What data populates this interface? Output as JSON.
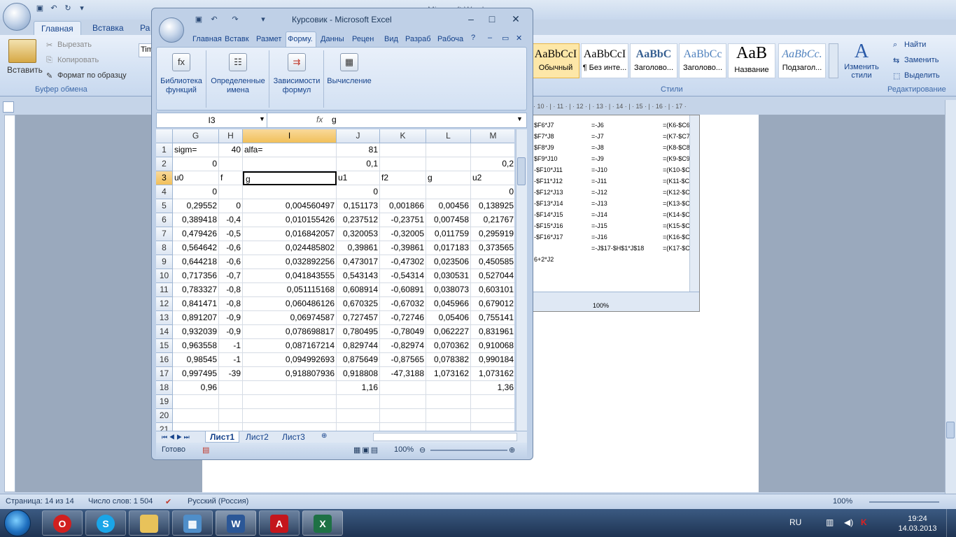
{
  "word": {
    "title": "Курсовик - Microsoft Word — документ … ерации - Microsoft Word",
    "title_visible": "ерации - Microsoft Word",
    "tabs": [
      "Главная",
      "Вставка",
      "Ра"
    ],
    "clipboard": {
      "paste": "Вставить",
      "cut": "Вырезать",
      "copy": "Копировать",
      "format_painter": "Формат по образцу",
      "group": "Буфер обмена"
    },
    "font_box": "Tim",
    "styles": [
      {
        "sample": "AaBbCcI",
        "name": "Обычный"
      },
      {
        "sample": "AaBbCcI",
        "name": "¶ Без инте..."
      },
      {
        "sample": "AaBbC",
        "name": "Заголово..."
      },
      {
        "sample": "AaBbCc",
        "name": "Заголово..."
      },
      {
        "sample": "AaB",
        "name": "Название"
      },
      {
        "sample": "AaBbCc.",
        "name": "Подзагол..."
      }
    ],
    "change_styles": "Изменить стили",
    "styles_group": "Стили",
    "editing": {
      "find": "Найти",
      "replace": "Заменить",
      "select": "Выделить",
      "group": "Редактирование"
    },
    "ruler_marks": "· 10 · | · 11 · | · 12 · | · 13 · | · 14 · | · 15 · | · 16 · | · 17 ·",
    "embedded": {
      "col1": [
        "$F6*J7",
        "$F7*J8",
        "$F8*J9",
        "$F9*J10",
        "-$F10*J11",
        "-$F11*J12",
        "-$F12*J13",
        "-$F13*J14",
        "-$F14*J15",
        "-$F15*J16",
        "-$F16*J17",
        "",
        "6+2*J2"
      ],
      "col2": [
        "=-J6",
        "=-J7",
        "=-J8",
        "=-J9",
        "=-J10",
        "=-J11",
        "=-J12",
        "=-J13",
        "=-J14",
        "=-J15",
        "=-J16",
        "=-J$17-$H$1*J$18",
        ""
      ],
      "col3": [
        "=(K6-$C6",
        "=(K7-$C7",
        "=(K8-$C8",
        "=(K9-$C9",
        "=(K10-$C",
        "=(K11-$C",
        "=(K12-$C",
        "=(K13-$C",
        "=(K14-$C",
        "=(K15-$C",
        "=(K16-$C",
        "=(K17-$C",
        ""
      ],
      "zoom": "100%"
    },
    "status": {
      "page": "Страница: 14 из 14",
      "words": "Число слов: 1 504",
      "language": "Русский (Россия)",
      "zoom": "100%"
    }
  },
  "excel": {
    "title": "Курсовик - Microsoft Excel",
    "tabs": [
      "Главная",
      "Вставк",
      "Размет",
      "Форму.",
      "Данны",
      "Рецен",
      "Вид",
      "Разраб",
      "Рабоча"
    ],
    "ribbon": [
      {
        "label1": "Библиотека",
        "label2": "функций",
        "icon": "fx"
      },
      {
        "label1": "Определенные",
        "label2": "имена",
        "icon": "names"
      },
      {
        "label1": "Зависимости",
        "label2": "формул",
        "icon": "deps"
      },
      {
        "label1": "Вычисление",
        "label2": "",
        "icon": "calc"
      }
    ],
    "namebox": "I3",
    "fx": "fx",
    "formula": "g",
    "columns": [
      "G",
      "H",
      "I",
      "J",
      "K",
      "L",
      "M"
    ],
    "rows": [
      {
        "n": "1",
        "c": [
          "sigm=",
          "40",
          "alfa=",
          "81",
          "",
          "",
          ""
        ]
      },
      {
        "n": "2",
        "c": [
          "0",
          "",
          "",
          "0,1",
          "",
          "",
          "0,2"
        ]
      },
      {
        "n": "3",
        "c": [
          "u0",
          "f",
          "g",
          "u1",
          "f2",
          "g",
          "u2"
        ]
      },
      {
        "n": "4",
        "c": [
          "0",
          "",
          "",
          "0",
          "",
          "",
          "0"
        ]
      },
      {
        "n": "5",
        "c": [
          "0,29552",
          "0",
          "0,004560497",
          "0,151173",
          "0,001866",
          "0,00456",
          "0,138925"
        ]
      },
      {
        "n": "6",
        "c": [
          "0,389418",
          "-0,4",
          "0,010155426",
          "0,237512",
          "-0,23751",
          "0,007458",
          "0,21767"
        ]
      },
      {
        "n": "7",
        "c": [
          "0,479426",
          "-0,5",
          "0,016842057",
          "0,320053",
          "-0,32005",
          "0,011759",
          "0,295919"
        ]
      },
      {
        "n": "8",
        "c": [
          "0,564642",
          "-0,6",
          "0,024485802",
          "0,39861",
          "-0,39861",
          "0,017183",
          "0,373565"
        ]
      },
      {
        "n": "9",
        "c": [
          "0,644218",
          "-0,6",
          "0,032892256",
          "0,473017",
          "-0,47302",
          "0,023506",
          "0,450585"
        ]
      },
      {
        "n": "10",
        "c": [
          "0,717356",
          "-0,7",
          "0,041843555",
          "0,543143",
          "-0,54314",
          "0,030531",
          "0,527044"
        ]
      },
      {
        "n": "11",
        "c": [
          "0,783327",
          "-0,8",
          "0,051115168",
          "0,608914",
          "-0,60891",
          "0,038073",
          "0,603101"
        ]
      },
      {
        "n": "12",
        "c": [
          "0,841471",
          "-0,8",
          "0,060486126",
          "0,670325",
          "-0,67032",
          "0,045966",
          "0,679012"
        ]
      },
      {
        "n": "13",
        "c": [
          "0,891207",
          "-0,9",
          "0,06974587",
          "0,727457",
          "-0,72746",
          "0,05406",
          "0,755141"
        ]
      },
      {
        "n": "14",
        "c": [
          "0,932039",
          "-0,9",
          "0,078698817",
          "0,780495",
          "-0,78049",
          "0,062227",
          "0,831961"
        ]
      },
      {
        "n": "15",
        "c": [
          "0,963558",
          "-1",
          "0,087167214",
          "0,829744",
          "-0,82974",
          "0,070362",
          "0,910068"
        ]
      },
      {
        "n": "16",
        "c": [
          "0,98545",
          "-1",
          "0,094992693",
          "0,875649",
          "-0,87565",
          "0,078382",
          "0,990184"
        ]
      },
      {
        "n": "17",
        "c": [
          "0,997495",
          "-39",
          "0,918807936",
          "0,918808",
          "-47,3188",
          "1,073162",
          "1,073162"
        ]
      },
      {
        "n": "18",
        "c": [
          "0,96",
          "",
          "",
          "1,16",
          "",
          "",
          "1,36"
        ]
      },
      {
        "n": "19",
        "c": [
          "",
          "",
          "",
          "",
          "",
          "",
          ""
        ]
      },
      {
        "n": "20",
        "c": [
          "",
          "",
          "",
          "",
          "",
          "",
          ""
        ]
      },
      {
        "n": "21",
        "c": [
          "",
          "",
          "",
          "",
          "",
          "",
          ""
        ]
      }
    ],
    "sheets": [
      "Лист1",
      "Лист2",
      "Лист3"
    ],
    "status": "Готово",
    "zoom": "100%"
  },
  "taskbar": {
    "lang": "RU",
    "time": "19:24",
    "date": "14.03.2013",
    "apps": [
      "opera",
      "skype",
      "explorer",
      "photos",
      "word",
      "pdf",
      "excel"
    ]
  },
  "colors": {
    "ribbon": "#d3e1f3",
    "selection_header": "#f1c05a",
    "taskbar": "#1e3352"
  }
}
